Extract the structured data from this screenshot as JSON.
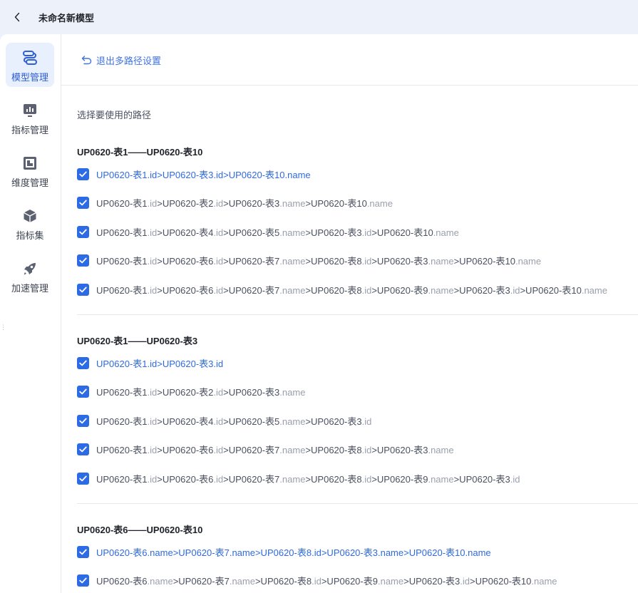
{
  "header": {
    "title": "未命名新模型"
  },
  "sidebar": {
    "items": [
      {
        "label": "模型管理",
        "icon": "model-icon",
        "active": true
      },
      {
        "label": "指标管理",
        "icon": "metric-icon",
        "active": false
      },
      {
        "label": "维度管理",
        "icon": "dimension-icon",
        "active": false
      },
      {
        "label": "指标集",
        "icon": "cube-icon",
        "active": false
      },
      {
        "label": "加速管理",
        "icon": "rocket-icon",
        "active": false
      }
    ]
  },
  "main": {
    "exit_label": "退出多路径设置",
    "section_title": "选择要使用的路径",
    "groups": [
      {
        "title": "UP0620-表1——UP0620-表10",
        "paths": [
          {
            "checked": true,
            "selected": true,
            "segments": [
              {
                "t": "UP0620-表1",
                "f": ".id"
              },
              {
                "t": ">UP0620-表3",
                "f": ".id"
              },
              {
                "t": ">UP0620-表10",
                "f": ".name"
              }
            ]
          },
          {
            "checked": true,
            "selected": false,
            "segments": [
              {
                "t": "UP0620-表1",
                "f": ".id"
              },
              {
                "t": ">UP0620-表2",
                "f": ".id"
              },
              {
                "t": ">UP0620-表3",
                "f": ".name"
              },
              {
                "t": ">UP0620-表10",
                "f": ".name"
              }
            ]
          },
          {
            "checked": true,
            "selected": false,
            "segments": [
              {
                "t": "UP0620-表1",
                "f": ".id"
              },
              {
                "t": ">UP0620-表4",
                "f": ".id"
              },
              {
                "t": ">UP0620-表5",
                "f": ".name"
              },
              {
                "t": ">UP0620-表3",
                "f": ".id"
              },
              {
                "t": ">UP0620-表10",
                "f": ".name"
              }
            ]
          },
          {
            "checked": true,
            "selected": false,
            "segments": [
              {
                "t": "UP0620-表1",
                "f": ".id"
              },
              {
                "t": ">UP0620-表6",
                "f": ".id"
              },
              {
                "t": ">UP0620-表7",
                "f": ".name"
              },
              {
                "t": ">UP0620-表8",
                "f": ".id"
              },
              {
                "t": ">UP0620-表3",
                "f": ".name"
              },
              {
                "t": ">UP0620-表10",
                "f": ".name"
              }
            ]
          },
          {
            "checked": true,
            "selected": false,
            "segments": [
              {
                "t": "UP0620-表1",
                "f": ".id"
              },
              {
                "t": ">UP0620-表6",
                "f": ".id"
              },
              {
                "t": ">UP0620-表7",
                "f": ".name"
              },
              {
                "t": ">UP0620-表8",
                "f": ".id"
              },
              {
                "t": ">UP0620-表9",
                "f": ".name"
              },
              {
                "t": ">UP0620-表3",
                "f": ".id"
              },
              {
                "t": ">UP0620-表10",
                "f": ".name"
              }
            ]
          }
        ]
      },
      {
        "title": "UP0620-表1——UP0620-表3",
        "paths": [
          {
            "checked": true,
            "selected": true,
            "segments": [
              {
                "t": "UP0620-表1",
                "f": ".id"
              },
              {
                "t": ">UP0620-表3",
                "f": ".id"
              }
            ]
          },
          {
            "checked": true,
            "selected": false,
            "segments": [
              {
                "t": "UP0620-表1",
                "f": ".id"
              },
              {
                "t": ">UP0620-表2",
                "f": ".id"
              },
              {
                "t": ">UP0620-表3",
                "f": ".name"
              }
            ]
          },
          {
            "checked": true,
            "selected": false,
            "segments": [
              {
                "t": "UP0620-表1",
                "f": ".id"
              },
              {
                "t": ">UP0620-表4",
                "f": ".id"
              },
              {
                "t": ">UP0620-表5",
                "f": ".name"
              },
              {
                "t": ">UP0620-表3",
                "f": ".id"
              }
            ]
          },
          {
            "checked": true,
            "selected": false,
            "segments": [
              {
                "t": "UP0620-表1",
                "f": ".id"
              },
              {
                "t": ">UP0620-表6",
                "f": ".id"
              },
              {
                "t": ">UP0620-表7",
                "f": ".name"
              },
              {
                "t": ">UP0620-表8",
                "f": ".id"
              },
              {
                "t": ">UP0620-表3",
                "f": ".name"
              }
            ]
          },
          {
            "checked": true,
            "selected": false,
            "segments": [
              {
                "t": "UP0620-表1",
                "f": ".id"
              },
              {
                "t": ">UP0620-表6",
                "f": ".id"
              },
              {
                "t": ">UP0620-表7",
                "f": ".name"
              },
              {
                "t": ">UP0620-表8",
                "f": ".id"
              },
              {
                "t": ">UP0620-表9",
                "f": ".name"
              },
              {
                "t": ">UP0620-表3",
                "f": ".id"
              }
            ]
          }
        ]
      },
      {
        "title": "UP0620-表6——UP0620-表10",
        "paths": [
          {
            "checked": true,
            "selected": true,
            "segments": [
              {
                "t": "UP0620-表6",
                "f": ".name"
              },
              {
                "t": ">UP0620-表7",
                "f": ".name"
              },
              {
                "t": ">UP0620-表8",
                "f": ".id"
              },
              {
                "t": ">UP0620-表3",
                "f": ".name"
              },
              {
                "t": ">UP0620-表10",
                "f": ".name"
              }
            ]
          },
          {
            "checked": true,
            "selected": false,
            "segments": [
              {
                "t": "UP0620-表6",
                "f": ".name"
              },
              {
                "t": ">UP0620-表7",
                "f": ".name"
              },
              {
                "t": ">UP0620-表8",
                "f": ".id"
              },
              {
                "t": ">UP0620-表9",
                "f": ".name"
              },
              {
                "t": ">UP0620-表3",
                "f": ".id"
              },
              {
                "t": ">UP0620-表10",
                "f": ".name"
              }
            ]
          }
        ]
      }
    ]
  },
  "colors": {
    "accent": "#2d6ae6",
    "selected_text": "#2f6ae0",
    "field_text": "#9aa0ab"
  }
}
